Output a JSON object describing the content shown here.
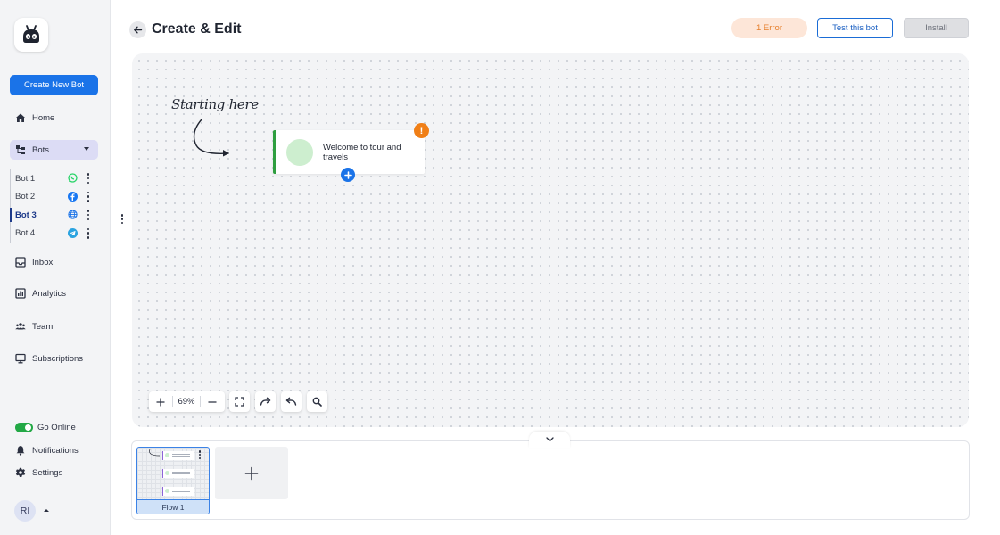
{
  "app": {
    "logo_icon": "bot-face-icon"
  },
  "sidebar": {
    "create_button": "Create New Bot",
    "items": [
      {
        "label": "Home",
        "icon": "home-icon"
      },
      {
        "label": "Bots",
        "icon": "bots-icon"
      },
      {
        "label": "Inbox",
        "icon": "inbox-icon"
      },
      {
        "label": "Analytics",
        "icon": "analytics-icon"
      },
      {
        "label": "Team",
        "icon": "team-icon"
      },
      {
        "label": "Subscriptions",
        "icon": "subscriptions-icon"
      }
    ],
    "bots": [
      {
        "label": "Bot 1",
        "channel": "whatsapp-icon",
        "color": "#25d366"
      },
      {
        "label": "Bot 2",
        "channel": "facebook-icon",
        "color": "#1877f2"
      },
      {
        "label": "Bot 3",
        "channel": "web-globe-icon",
        "color": "#1a73e8",
        "active": true
      },
      {
        "label": "Bot 4",
        "channel": "telegram-icon",
        "color": "#2aa3e0"
      }
    ],
    "bottom": {
      "go_online": "Go Online",
      "go_online_enabled": true,
      "notifications": "Notifications",
      "settings": "Settings"
    },
    "user": {
      "initials": "RI"
    }
  },
  "header": {
    "title": "Create & Edit",
    "error_badge": "1 Error",
    "test_button": "Test this bot",
    "install_button": "Install"
  },
  "canvas": {
    "annotation": "Starting here",
    "start_node": {
      "text": "Welcome to tour and travels",
      "alert": "!"
    },
    "zoom": {
      "level": "69%"
    }
  },
  "flows": {
    "items": [
      {
        "label": "Flow 1"
      }
    ]
  },
  "colors": {
    "primary": "#1a73e8",
    "error_bg": "#fde6d8",
    "error_text": "#e67f2c",
    "success": "#2e9e3f",
    "alert": "#f07f17"
  }
}
